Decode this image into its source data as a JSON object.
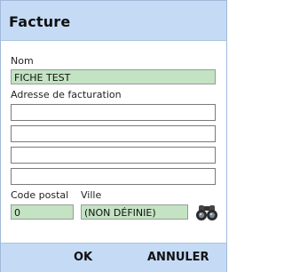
{
  "window": {
    "title": "Facture"
  },
  "form": {
    "nom_label": "Nom",
    "nom_value": "FICHE TEST",
    "adresse_label": "Adresse de facturation",
    "adresse_lines": [
      "",
      "",
      "",
      ""
    ],
    "code_postal_label": "Code postal",
    "code_postal_value": "0",
    "ville_label": "Ville",
    "ville_value": "(NON DÉFINIE)",
    "search_icon": "binoculars-icon"
  },
  "footer": {
    "ok_label": "OK",
    "cancel_label": "ANNULER"
  },
  "colors": {
    "header_bg": "#c5dbf5",
    "field_green": "#c3e3c3",
    "border": "#9fb9d8"
  }
}
